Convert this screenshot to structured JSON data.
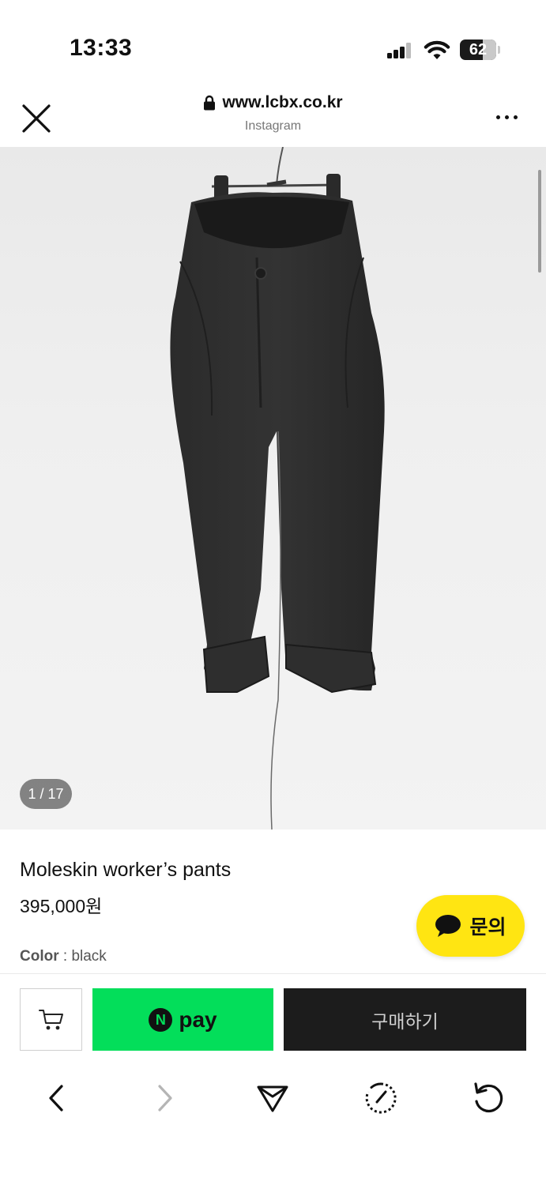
{
  "status_bar": {
    "time": "13:33",
    "battery_level": "62",
    "icons": [
      "signal-icon",
      "wifi-icon",
      "battery-icon"
    ]
  },
  "browser": {
    "url": "www.lcbx.co.kr",
    "source": "Instagram",
    "icons": [
      "close-icon",
      "lock-icon",
      "more-icon"
    ]
  },
  "gallery": {
    "counter": "1 / 17",
    "image_subject": "black moleskin worker's pants on hanger"
  },
  "product": {
    "title": "Moleskin worker’s pants",
    "price": "395,000원",
    "color_label": "Color",
    "color_sep": " : ",
    "color_value": "black"
  },
  "inquiry": {
    "label": "문의",
    "icon": "chat-bubble-icon",
    "color": "#ffe512"
  },
  "purchase_bar": {
    "cart_icon": "cart-icon",
    "npay_badge": "N",
    "npay_label": "pay",
    "npay_color": "#03de5a",
    "buy_label": "구매하기",
    "buy_color": "#1c1c1c"
  },
  "toolbar": {
    "icons": [
      "back-icon",
      "forward-icon",
      "share-icon",
      "speed-icon",
      "reload-icon"
    ]
  }
}
